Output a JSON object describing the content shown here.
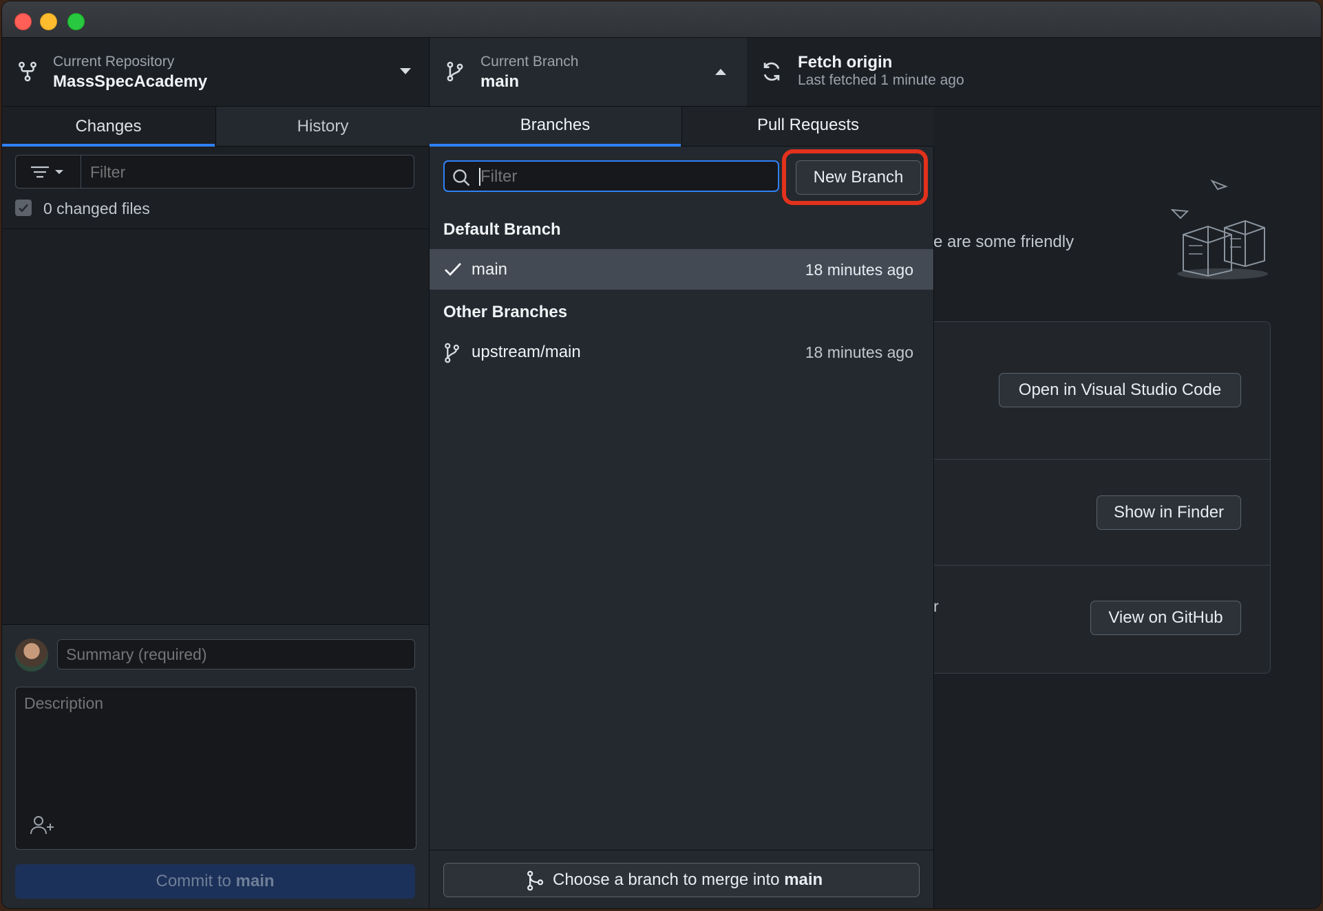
{
  "toolbar": {
    "repo_label": "Current Repository",
    "repo_name": "MassSpecAcademy",
    "branch_label": "Current Branch",
    "branch_name": "main",
    "fetch_title": "Fetch origin",
    "fetch_subtitle": "Last fetched 1 minute ago"
  },
  "sidebar": {
    "tabs": [
      {
        "label": "Changes"
      },
      {
        "label": "History"
      }
    ],
    "filter_placeholder": "Filter",
    "changed_files": "0 changed files",
    "summary_placeholder": "Summary (required)",
    "description_placeholder": "Description",
    "commit_prefix": "Commit to ",
    "commit_branch": "main"
  },
  "branch_dropdown": {
    "tabs": [
      {
        "label": "Branches"
      },
      {
        "label": "Pull Requests"
      }
    ],
    "filter_placeholder": "Filter",
    "new_branch_label": "New Branch",
    "default_section": "Default Branch",
    "default_branches": [
      {
        "name": "main",
        "time": "18 minutes ago"
      }
    ],
    "other_section": "Other Branches",
    "other_branches": [
      {
        "name": "upstream/main",
        "time": "18 minutes ago"
      }
    ],
    "merge_prefix": "Choose a branch to merge into ",
    "merge_branch": "main"
  },
  "background": {
    "partial_text": "e are some friendly",
    "partial_char": "r",
    "buttons": [
      {
        "label": "Open in Visual Studio Code"
      },
      {
        "label": "Show in Finder"
      },
      {
        "label": "View on GitHub"
      }
    ]
  },
  "highlight_color": "#e2311c",
  "accent_color": "#2f81f7"
}
